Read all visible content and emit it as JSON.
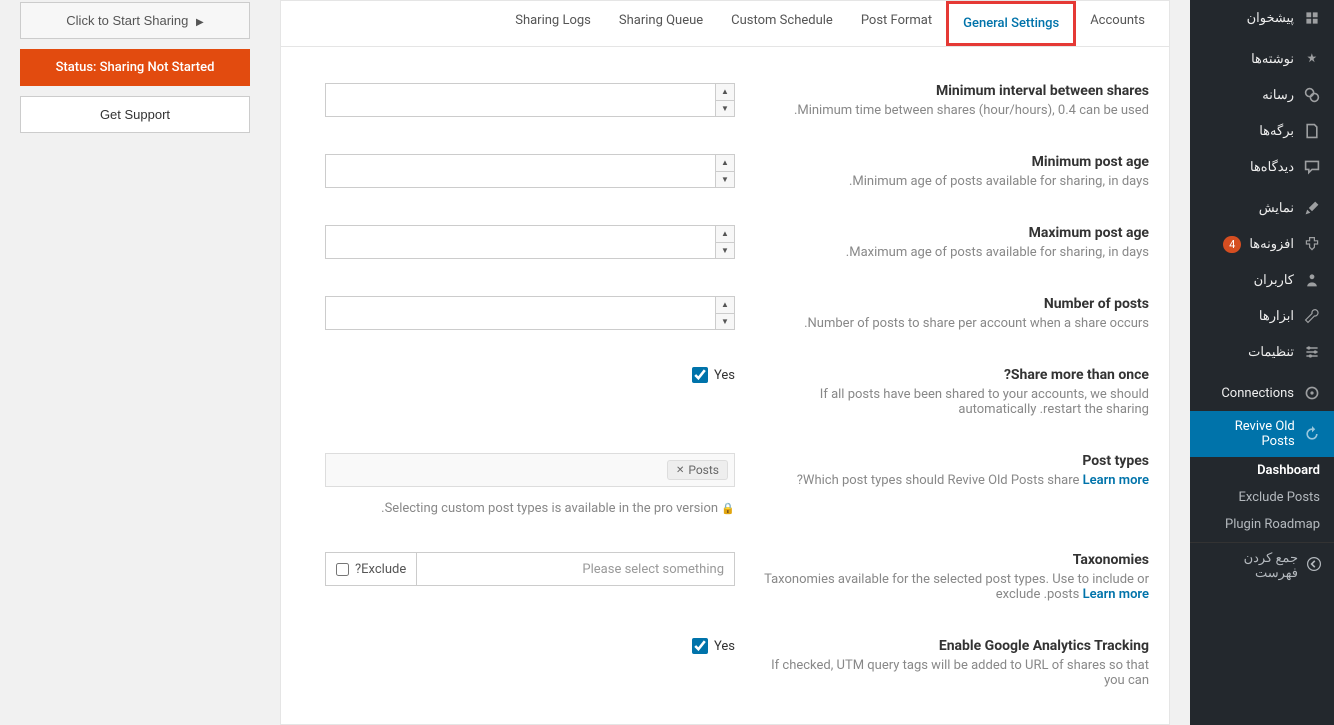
{
  "sidebar": {
    "dashboard": "پیشخوان",
    "posts": "نوشته‌ها",
    "media": "رسانه",
    "pages": "برگه‌ها",
    "comments": "دیدگاه‌ها",
    "appearance": "نمایش",
    "plugins": "افزونه‌ها",
    "plugins_badge": "4",
    "users": "کاربران",
    "tools": "ابزارها",
    "settings": "تنظیمات",
    "connections": "Connections",
    "revive": "Revive Old Posts",
    "sub_dashboard": "Dashboard",
    "sub_exclude": "Exclude Posts",
    "sub_roadmap": "Plugin Roadmap",
    "collapse": "جمع کردن فهرست"
  },
  "tabs": {
    "accounts": "Accounts",
    "general_settings": "General Settings",
    "post_format": "Post Format",
    "custom_schedule": "Custom Schedule",
    "sharing_queue": "Sharing Queue",
    "sharing_logs": "Sharing Logs"
  },
  "settings": {
    "min_interval": {
      "title": "Minimum interval between shares",
      "desc": ".Minimum time between shares (hour/hours), 0.4 can be used"
    },
    "min_age": {
      "title": "Minimum post age",
      "desc": ".Minimum age of posts available for sharing, in days"
    },
    "max_age": {
      "title": "Maximum post age",
      "desc": ".Maximum age of posts available for sharing, in days"
    },
    "num_posts": {
      "title": "Number of posts",
      "desc": ".Number of posts to share per account when a share occurs"
    },
    "share_more": {
      "title": "?Share more than once",
      "desc": "If all posts have been shared to your accounts, we should automatically .restart the sharing",
      "yes": "Yes"
    },
    "post_types": {
      "title": "Post types",
      "desc_pre": "?Which post types should Revive Old Posts share ",
      "learn": "Learn more",
      "chip": "Posts",
      "pro_note": ".Selecting custom post types is available in the pro version"
    },
    "taxonomies": {
      "title": "Taxonomies",
      "desc_pre": "Taxonomies available for the selected post types. Use to include or exclude .posts ",
      "learn": "Learn more",
      "placeholder": "Please select something",
      "exclude": "?Exclude"
    },
    "ga": {
      "title": "Enable Google Analytics Tracking",
      "desc": "If checked, UTM query tags will be added to URL of shares so that you can",
      "yes": "Yes"
    }
  },
  "side": {
    "start": "Click to Start Sharing",
    "status": "Status: Sharing Not Started",
    "support": "Get Support"
  }
}
